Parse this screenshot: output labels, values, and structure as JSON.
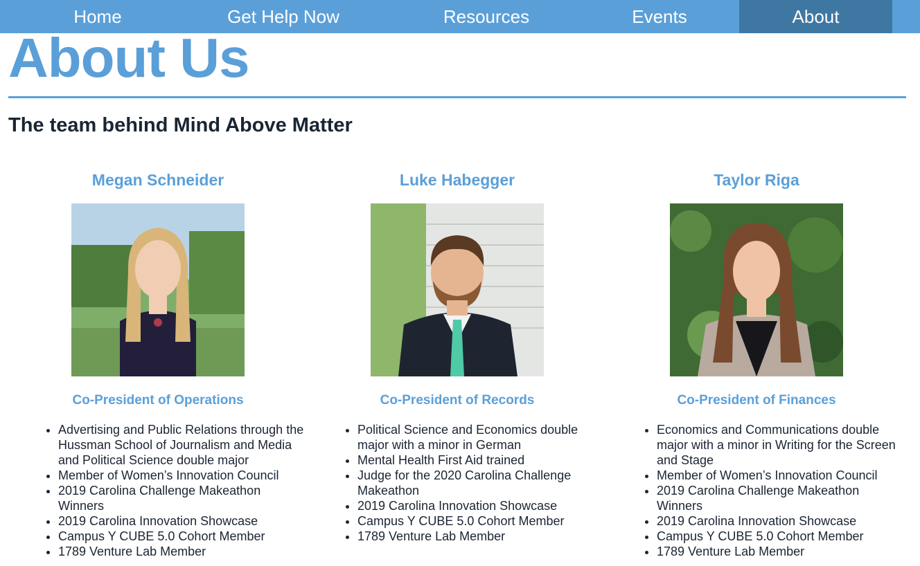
{
  "nav": {
    "items": [
      {
        "label": "Home"
      },
      {
        "label": "Get Help Now"
      },
      {
        "label": "Resources"
      },
      {
        "label": "Events"
      },
      {
        "label": "About"
      }
    ],
    "active": "About"
  },
  "page": {
    "title": "About Us",
    "subtitle": "The team behind Mind Above Matter"
  },
  "colors": {
    "accent": "#5b9fd8",
    "nav_active": "#3f77a3",
    "text": "#1a2533"
  },
  "team": [
    {
      "name": "Megan Schneider",
      "role": "Co-President of Operations",
      "photo_icon": "portrait-photo-icon",
      "facts": [
        "Advertising and Public Relations through the Hussman School of Journalism and Media and Political Science double major",
        "Member of Women’s Innovation Council",
        "2019 Carolina Challenge Makeathon Winners",
        "2019 Carolina Innovation Showcase",
        "Campus Y CUBE 5.0 Cohort Member",
        "1789 Venture Lab Member"
      ]
    },
    {
      "name": "Luke Habegger",
      "role": "Co-President of Records",
      "photo_icon": "portrait-photo-icon",
      "facts": [
        "Political Science and Economics double major with a minor in German",
        "Mental Health First Aid trained",
        "Judge for the 2020 Carolina Challenge Makeathon",
        "2019 Carolina Innovation Showcase",
        "Campus Y CUBE 5.0 Cohort Member",
        "1789 Venture Lab Member"
      ]
    },
    {
      "name": "Taylor Riga",
      "role": "Co-President of Finances",
      "photo_icon": "portrait-photo-icon",
      "facts": [
        "Economics and Communications double major with a minor in Writing for the Screen and Stage",
        "Member of Women’s Innovation Council",
        "2019 Carolina Challenge Makeathon Winners",
        "2019 Carolina Innovation Showcase",
        "Campus Y CUBE 5.0 Cohort Member",
        "1789 Venture Lab Member"
      ]
    }
  ]
}
